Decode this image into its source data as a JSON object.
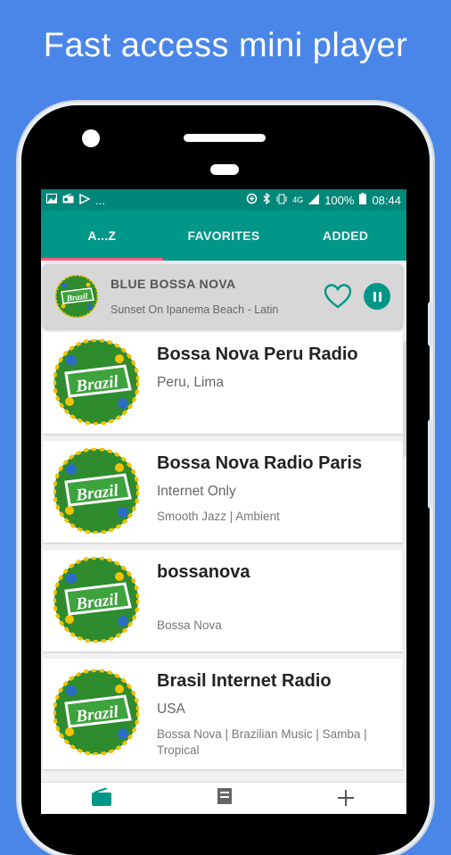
{
  "headline": "Fast access mini player",
  "statusbar": {
    "dots": "...",
    "battery": "100%",
    "time": "08:44",
    "network": "4G"
  },
  "tabs": [
    {
      "label": "A...Z",
      "active": true
    },
    {
      "label": "FAVORITES",
      "active": false
    },
    {
      "label": "ADDED",
      "active": false
    }
  ],
  "miniplayer": {
    "title": "BLUE BOSSA NOVA",
    "subtitle": "Sunset On Ipanema Beach - Latin",
    "heart_icon": "heart-outline-icon",
    "pause_icon": "pause-icon"
  },
  "stations": [
    {
      "name": "Bossa Nova Peru Radio",
      "location": "Peru, Lima",
      "genres": ""
    },
    {
      "name": "Bossa Nova Radio Paris",
      "location": "Internet Only",
      "genres": "Smooth Jazz | Ambient"
    },
    {
      "name": "bossanova",
      "location": "",
      "genres": "Bossa Nova"
    },
    {
      "name": "Brasil Internet Radio",
      "location": "USA",
      "genres": "Bossa Nova | Brazilian Music | Samba | Tropical"
    }
  ],
  "logo_text": "Brazil",
  "colors": {
    "background": "#4a86e8",
    "primary": "#009688",
    "status_bar": "#00877a",
    "tab_indicator": "#ff5a7a"
  },
  "bottomnav": [
    "radio-icon",
    "list-icon",
    "add-icon"
  ]
}
